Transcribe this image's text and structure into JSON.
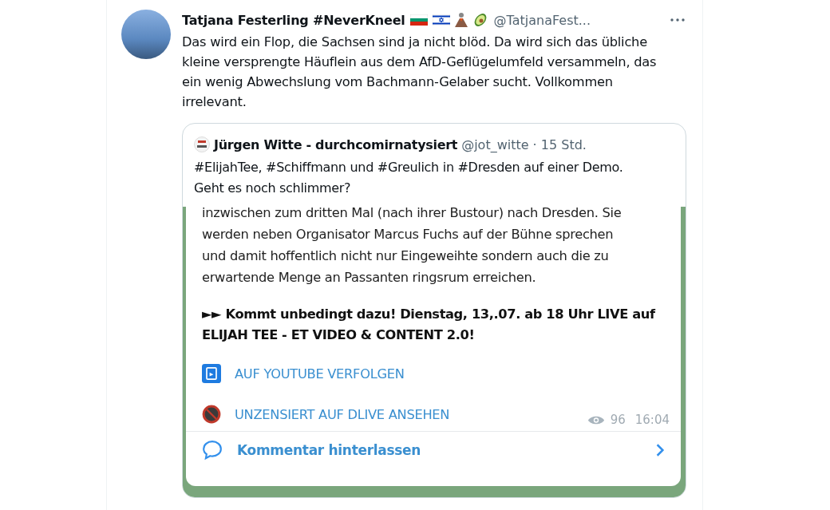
{
  "tweet": {
    "author": "Tatjana Festerling #NeverKneel",
    "handle": "@TatjanaFest...",
    "text_lines": [
      "Das wird ein Flop, die Sachsen sind ja nicht blöd. Da wird sich das übliche",
      "kleine versprengte Häuflein aus dem AfD-Geflügelumfeld versammeln, das",
      "ein wenig Abwechslung vom Bachmann-Gelaber sucht. Vollkommen",
      "irrelevant."
    ],
    "quote": {
      "author": "Jürgen Witte - durchcomirnatysiert",
      "handle": "@jot_witte",
      "time": "· 15 Std.",
      "text_lines": [
        "#ElijahTee, #Schiffmann und #Greulich in #Dresden auf einer Demo.",
        "Geht es noch schlimmer?"
      ],
      "image": {
        "paragraph_lines": [
          "inzwischen zum dritten Mal (nach ihrer Bustour) nach Dresden. Sie",
          "werden neben Organisator Marcus Fuchs auf der Bühne sprechen",
          "und damit hoffentlich nicht  nur Eingeweihte sondern auch die zu",
          "erwartende Menge an Passanten ringsrum erreichen."
        ],
        "bold_lines": [
          "►► Kommt unbedingt dazu! Dienstag, 13,.07. ab 18 Uhr LIVE auf",
          "ELIJAH TEE - ET VIDEO & CONTENT 2.0!"
        ],
        "links": [
          {
            "kind": "youtube",
            "text": "AUF YOUTUBE VERFOLGEN"
          },
          {
            "kind": "dlive",
            "text": "UNZENSIERT AUF DLIVE ANSEHEN"
          }
        ],
        "views": "96",
        "time": "16:04",
        "comment": "Kommentar hinterlassen"
      }
    }
  }
}
